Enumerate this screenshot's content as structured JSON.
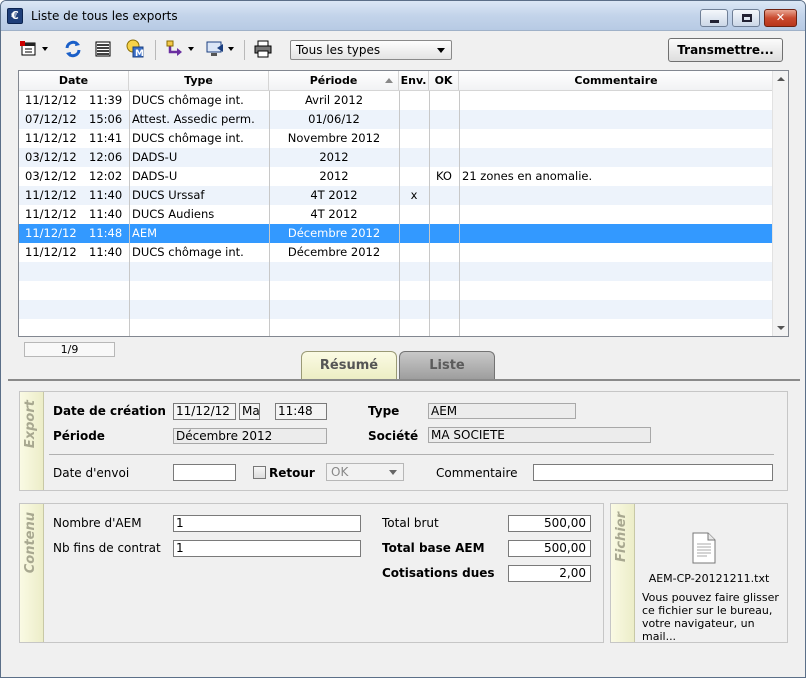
{
  "window": {
    "title": "Liste de tous les exports",
    "app_icon_letter": "€"
  },
  "toolbar": {
    "type_filter": "Tous les types",
    "transmit_label": "Transmettre...",
    "icons": [
      "export-wizard-icon",
      "refresh-icon",
      "list-view-icon",
      "badge-m-icon",
      "import-arrow-icon",
      "monitor-icon",
      "printer-icon"
    ]
  },
  "grid": {
    "columns": [
      "Date",
      "Type",
      "Période",
      "Env.",
      "OK",
      "Commentaire"
    ],
    "rows": [
      {
        "date": "11/12/12",
        "time": "11:39",
        "type": "DUCS chômage int.",
        "period": "Avril 2012",
        "env": "",
        "ok": "",
        "comment": ""
      },
      {
        "date": "07/12/12",
        "time": "15:06",
        "type": "Attest. Assedic perm.",
        "period": "01/06/12",
        "env": "",
        "ok": "",
        "comment": ""
      },
      {
        "date": "11/12/12",
        "time": "11:41",
        "type": "DUCS chômage int.",
        "period": "Novembre 2012",
        "env": "",
        "ok": "",
        "comment": ""
      },
      {
        "date": "03/12/12",
        "time": "12:06",
        "type": "DADS-U",
        "period": "2012",
        "env": "",
        "ok": "",
        "comment": ""
      },
      {
        "date": "03/12/12",
        "time": "12:02",
        "type": "DADS-U",
        "period": "2012",
        "env": "",
        "ok": "KO",
        "comment": "21 zones en anomalie."
      },
      {
        "date": "11/12/12",
        "time": "11:40",
        "type": "DUCS Urssaf",
        "period": "4T 2012",
        "env": "x",
        "ok": "",
        "comment": ""
      },
      {
        "date": "11/12/12",
        "time": "11:40",
        "type": "DUCS Audiens",
        "period": "4T 2012",
        "env": "",
        "ok": "",
        "comment": ""
      },
      {
        "date": "11/12/12",
        "time": "11:48",
        "type": "AEM",
        "period": "Décembre 2012",
        "env": "",
        "ok": "",
        "comment": ""
      },
      {
        "date": "11/12/12",
        "time": "11:40",
        "type": "DUCS chômage int.",
        "period": "Décembre 2012",
        "env": "",
        "ok": "",
        "comment": ""
      }
    ],
    "selected_index": 7,
    "counter": "1/9"
  },
  "tabs": {
    "summary": "Résumé",
    "list": "Liste"
  },
  "export": {
    "section": "Export",
    "creation_label": "Date de création",
    "creation_date": "11/12/12",
    "creation_day": "Ma",
    "creation_time": "11:48",
    "type_label": "Type",
    "type_value": "AEM",
    "period_label": "Période",
    "period_value": "Décembre 2012",
    "company_label": "Société",
    "company_value": "MA SOCIETE",
    "send_date_label": "Date d'envoi",
    "send_date_value": "",
    "return_label": "Retour",
    "status_value": "OK",
    "comment_label": "Commentaire",
    "comment_value": ""
  },
  "content": {
    "section": "Contenu",
    "aem_count_label": "Nombre d'AEM",
    "aem_count": "1",
    "contract_end_label": "Nb fins de contrat",
    "contract_end": "1",
    "gross_label": "Total brut",
    "gross": "500,00",
    "aem_base_label": "Total base AEM",
    "aem_base": "500,00",
    "contrib_label": "Cotisations dues",
    "contrib": "2,00"
  },
  "file": {
    "section": "Fichier",
    "name": "AEM-CP-20121211.txt",
    "hint": "Vous pouvez faire glisser ce fichier sur le bureau, votre navigateur, un mail..."
  }
}
